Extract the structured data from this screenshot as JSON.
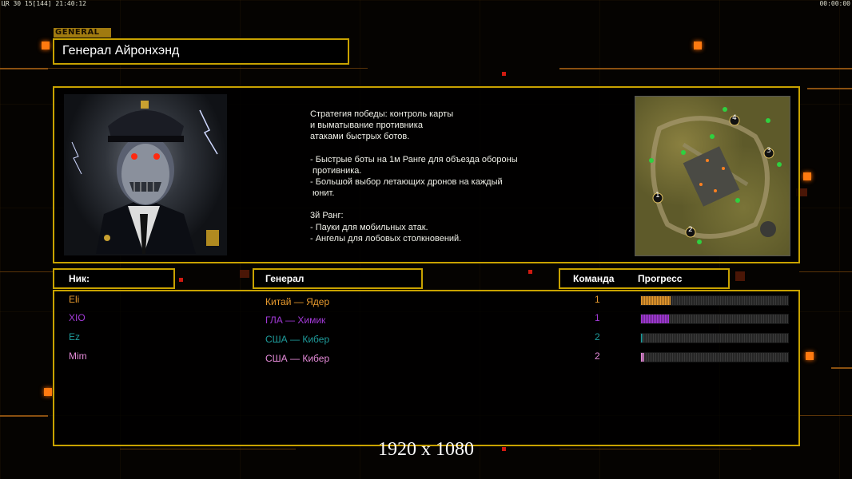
{
  "hud": {
    "left_status": "ЦR 30 15[144] 21:40:12",
    "right_clock": "00:00:00"
  },
  "general_tag": "GENERAL",
  "title": "Генерал Айронхэнд",
  "description": [
    "Стратегия победы: контроль карты",
    "и выматывание противника",
    "атаками быстрых ботов.",
    "",
    "- Быстрые боты на 1м Ранге для объезда обороны",
    " противника.",
    "- Большой выбор летающих дронов на каждый",
    " юнит.",
    "",
    "3й Ранг:",
    "- Пауки для мобильных атак.",
    "- Ангелы для лобовых столкновений."
  ],
  "map_markers": [
    "1",
    "2",
    "3",
    "4"
  ],
  "table_headers": {
    "nick": "Ник:",
    "general": "Генерал",
    "team": "Команда",
    "progress": "Прогресс"
  },
  "players": [
    {
      "nick": "Eli",
      "general": "Китай — Ядер",
      "team": "1",
      "progress": 0.2,
      "color": "#e89a2e"
    },
    {
      "nick": "XIO",
      "general": "ГЛА — Химик",
      "team": "1",
      "progress": 0.19,
      "color": "#a43ad8"
    },
    {
      "nick": "Ez",
      "general": "США — Кибер",
      "team": "2",
      "progress": 0.01,
      "color": "#1f9c9c"
    },
    {
      "nick": "Mim",
      "general": "США — Кибер",
      "team": "2",
      "progress": 0.02,
      "color": "#e58ad8"
    }
  ],
  "resolution": "1920 x 1080",
  "colors": {
    "frame": "#c8a200",
    "accent": "#ff7a10",
    "background": "#050301"
  }
}
